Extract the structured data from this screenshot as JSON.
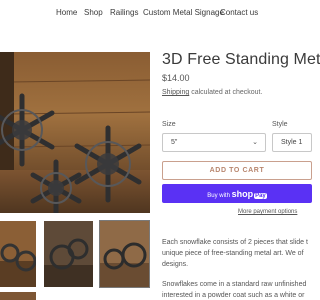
{
  "nav": {
    "items": [
      "Home",
      "Shop",
      "Railings",
      "Custom Metal Signage",
      "Contact us"
    ]
  },
  "product": {
    "title": "3D Free Standing Meta",
    "price": "$14.00",
    "shipping_link": "Shipping",
    "shipping_rest": " calculated at checkout.",
    "size_label": "Size",
    "size_value": "5\"",
    "style_label": "Style",
    "style_value": "Style 1",
    "add_to_cart": "ADD TO CART",
    "buy_with": "Buy with ",
    "shop_brand": "shop",
    "shop_pay": "Pay",
    "more_payment": "More payment options",
    "desc_lines": [
      "Each snowflake consists of 2 pieces that slide t",
      "unique piece of free-standing metal art. We of",
      "designs."
    ],
    "desc_lines2": [
      "Snowflakes come in a standard raw unfinished",
      "interested in a powder coat such as a white or"
    ]
  },
  "colors": {
    "accent_border": "#c9a08e",
    "shop_pay": "#5a31f4"
  }
}
